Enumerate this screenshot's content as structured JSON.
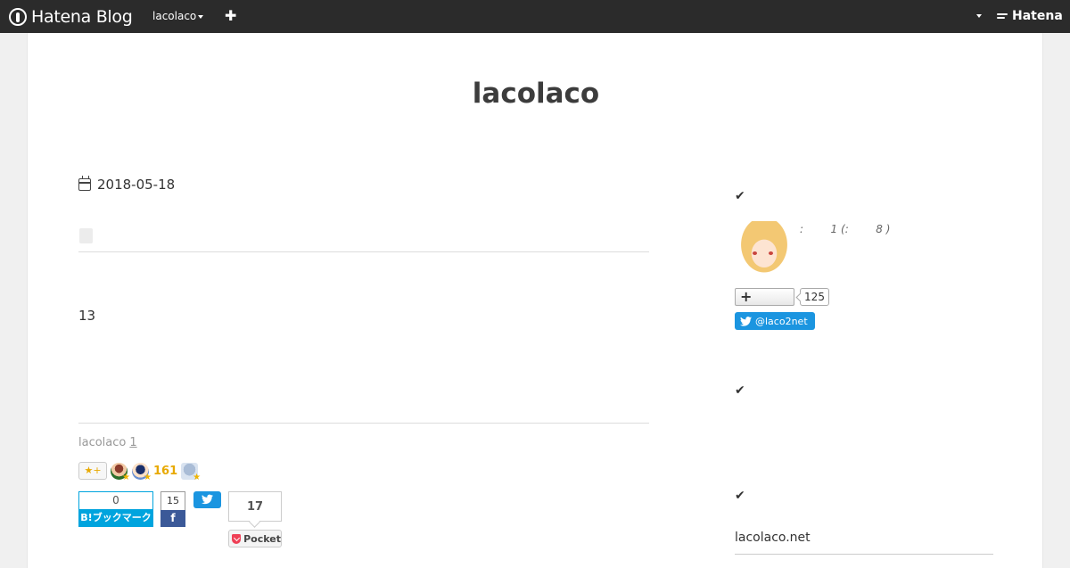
{
  "topbar": {
    "brand": "Hatena Blog",
    "blog_switch": "lacolaco",
    "plus": "✚",
    "hatena_logo": "Hatena",
    "icons": [
      "hatena-blog-logo-icon",
      "caret-down-icon",
      "plus-icon",
      "hatena-wings-icon"
    ]
  },
  "blog": {
    "title": "lacolaco"
  },
  "entry": {
    "date": "2018-05-18",
    "body": "13",
    "author": "lacolaco",
    "comment_count": "1",
    "stars": {
      "add_label": "★+",
      "count": "161"
    },
    "share": {
      "hatena_count": "0",
      "hatena_label": "B!ブックマーク",
      "facebook_count": "15",
      "facebook_label": "f",
      "pocket_count": "17",
      "pocket_label": "Pocket"
    }
  },
  "sidebar": {
    "check_icon": "✔",
    "profile_meta": ":        1 (:        8 )",
    "follow_plus": "+",
    "follow_count": "125",
    "twitter_handle": "@laco2net",
    "link": "lacolaco.net"
  },
  "colors": {
    "topbar": "#2b2b2b",
    "hatena_blue": "#00a4de",
    "facebook": "#3b5998",
    "twitter": "#1b95e0",
    "star": "#e8a900",
    "pocket": "#ef4056"
  }
}
